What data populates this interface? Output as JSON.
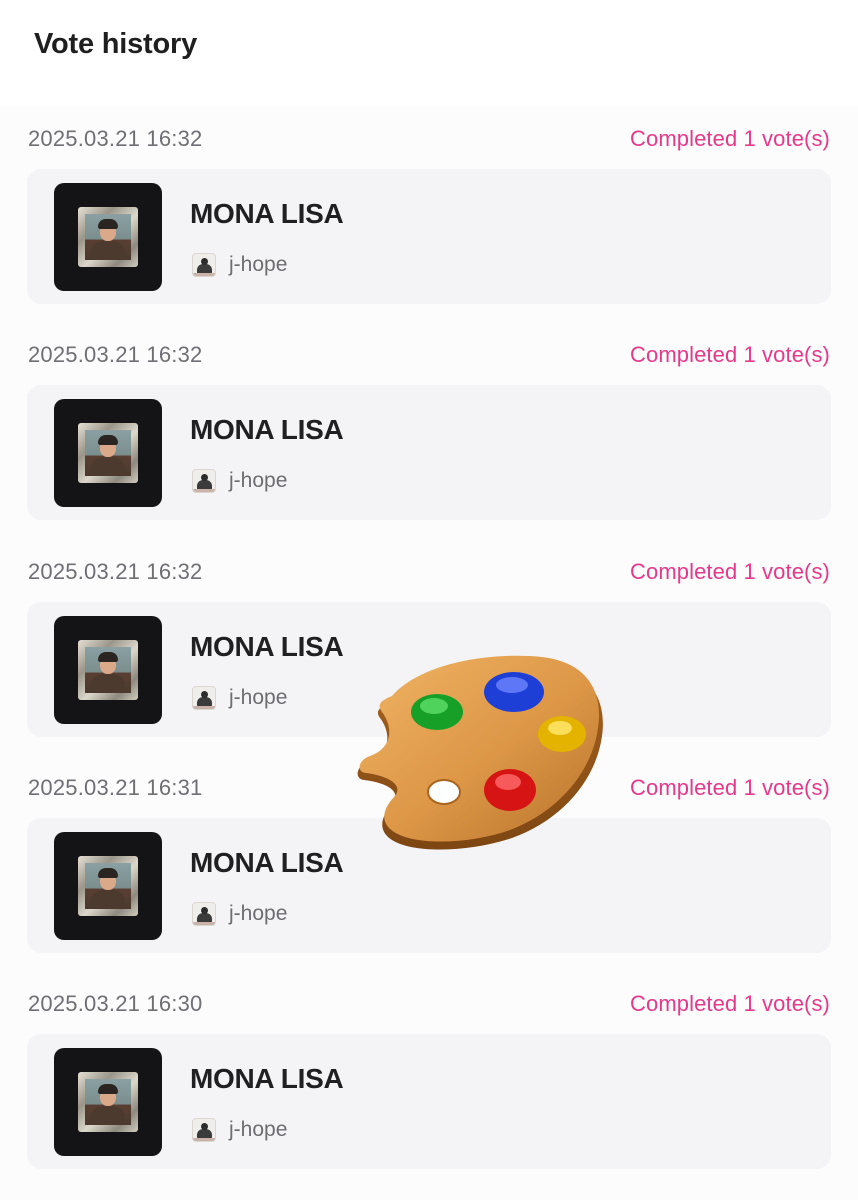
{
  "header": {
    "title": "Vote history"
  },
  "entries": [
    {
      "date": "2025.03.21 16:32",
      "status": "Completed 1 vote(s)",
      "title": "MONA LISA",
      "artist": "j-hope"
    },
    {
      "date": "2025.03.21 16:32",
      "status": "Completed 1 vote(s)",
      "title": "MONA LISA",
      "artist": "j-hope"
    },
    {
      "date": "2025.03.21 16:32",
      "status": "Completed 1 vote(s)",
      "title": "MONA LISA",
      "artist": "j-hope"
    },
    {
      "date": "2025.03.21 16:31",
      "status": "Completed 1 vote(s)",
      "title": "MONA LISA",
      "artist": "j-hope"
    },
    {
      "date": "2025.03.21 16:30",
      "status": "Completed 1 vote(s)",
      "title": "MONA LISA",
      "artist": "j-hope"
    }
  ],
  "colors": {
    "status": "#e5398a",
    "card": "#f4f4f6",
    "thumb": "#141416"
  },
  "icons": {
    "thumbnail": "framed-portrait-icon",
    "artist": "artist-avatar-icon",
    "overlay": "paint-palette-icon"
  }
}
